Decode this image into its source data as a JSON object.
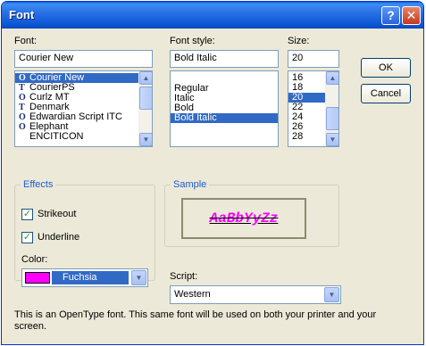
{
  "window": {
    "title": "Font",
    "help_glyph": "?",
    "close_glyph": "✕"
  },
  "font": {
    "label": "Font:",
    "value": "Courier New",
    "items": [
      {
        "name": "Courier New",
        "icon": "O",
        "selected": true
      },
      {
        "name": "CourierPS",
        "icon": "T",
        "selected": false
      },
      {
        "name": "Curlz MT",
        "icon": "O",
        "selected": false
      },
      {
        "name": "Denmark",
        "icon": "T",
        "selected": false
      },
      {
        "name": "Edwardian Script ITC",
        "icon": "O",
        "selected": false
      },
      {
        "name": "Elephant",
        "icon": "O",
        "selected": false
      },
      {
        "name": "ENCITICON",
        "icon": "",
        "selected": false
      }
    ]
  },
  "style": {
    "label": "Font style:",
    "value": "Bold Italic",
    "items": [
      {
        "name": "Regular",
        "selected": false
      },
      {
        "name": "Italic",
        "selected": false
      },
      {
        "name": "Bold",
        "selected": false
      },
      {
        "name": "Bold Italic",
        "selected": true
      }
    ]
  },
  "size": {
    "label": "Size:",
    "value": "20",
    "items": [
      {
        "name": "16",
        "selected": false
      },
      {
        "name": "18",
        "selected": false
      },
      {
        "name": "20",
        "selected": true
      },
      {
        "name": "22",
        "selected": false
      },
      {
        "name": "24",
        "selected": false
      },
      {
        "name": "26",
        "selected": false
      },
      {
        "name": "28",
        "selected": false
      }
    ]
  },
  "buttons": {
    "ok": "OK",
    "cancel": "Cancel"
  },
  "effects": {
    "label": "Effects",
    "strikeout": {
      "label": "Strikeout",
      "checked": true
    },
    "underline": {
      "label": "Underline",
      "checked": true
    },
    "check_glyph": "✓",
    "color_label": "Color:",
    "color_value": "Fuchsia",
    "color_swatch": "#ff00ff"
  },
  "sample": {
    "label": "Sample",
    "text": "AaBbYyZz",
    "color": "#ff00ff"
  },
  "script": {
    "label": "Script:",
    "value": "Western"
  },
  "info": "This is an OpenType font. This same font will be used on both your printer and your screen.",
  "icons": {
    "scroll_up": "▲",
    "scroll_down": "▼",
    "dropdown": "▼"
  },
  "colors": {
    "selection": "#316ac5",
    "titlebar": "#0b55d2",
    "dialog_bg": "#ece9d8",
    "group_title": "#1d5dd0"
  }
}
